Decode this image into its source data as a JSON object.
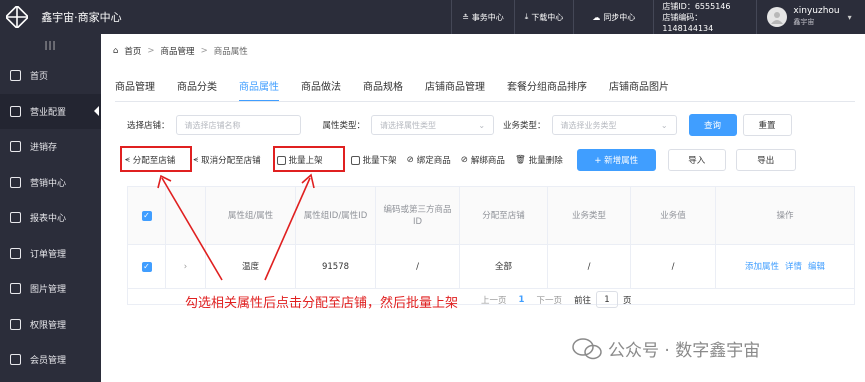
{
  "topbar": {
    "brand": "鑫宇宙·商家中心",
    "tasks": "事务中心",
    "downloads": "下载中心",
    "sync": "同步中心",
    "store_id": "店铺ID：6555146",
    "store_code": "店铺编码：1148144134",
    "user_name": "xinyuzhou",
    "user_sub": "鑫宇宙",
    "dropdown_arrow": "▾"
  },
  "sidebar": {
    "collapse": "|||",
    "items": [
      {
        "label": "首页",
        "icon": "home-icon"
      },
      {
        "label": "营业配置",
        "icon": "store-icon"
      },
      {
        "label": "进销存",
        "icon": "inventory-icon"
      },
      {
        "label": "营销中心",
        "icon": "marketing-icon"
      },
      {
        "label": "报表中心",
        "icon": "report-icon"
      },
      {
        "label": "订单管理",
        "icon": "order-icon"
      },
      {
        "label": "图片管理",
        "icon": "image-icon"
      },
      {
        "label": "权限管理",
        "icon": "permission-icon"
      },
      {
        "label": "会员管理",
        "icon": "member-icon"
      }
    ]
  },
  "breadcrumb": {
    "home": "首页",
    "sep": ">",
    "section": "商品管理",
    "current": "商品属性"
  },
  "tabs": [
    "商品管理",
    "商品分类",
    "商品属性",
    "商品做法",
    "商品规格",
    "店铺商品管理",
    "套餐分组商品排序",
    "店铺商品图片"
  ],
  "filters": {
    "store_label": "选择店铺：",
    "store_placeholder": "请选择店铺名称",
    "attr_type_label": "属性类型：",
    "attr_type_placeholder": "请选择属性类型",
    "biz_type_label": "业务类型：",
    "biz_type_placeholder": "请选择业务类型",
    "query": "查询",
    "reset": "重置"
  },
  "actions": {
    "assign": "分配至店铺",
    "unassign": "取消分配至店铺",
    "batch_on": "批量上架",
    "batch_off": "批量下架",
    "bind": "绑定商品",
    "unbind": "解绑商品",
    "batch_delete": "批量删除",
    "add_attr": "+ 新增属性",
    "import": "导入",
    "export": "导出"
  },
  "table": {
    "headers": [
      "属性组/属性",
      "属性组ID/属性ID",
      "编码或第三方商品ID",
      "分配至店铺",
      "业务类型",
      "业务值",
      "操作"
    ],
    "row": {
      "name": "温度",
      "id": "91578",
      "code": "/",
      "store": "全部",
      "biz_type": "/",
      "biz_value": "/",
      "ops": [
        "添加属性",
        "详情",
        "编辑"
      ]
    }
  },
  "pager": {
    "prev": "上一页",
    "page": "1",
    "next": "下一页",
    "goto_prefix": "前往",
    "goto_value": "1",
    "goto_suffix": "页"
  },
  "annotation": "勾选相关属性后点击分配至店铺，然后批量上架",
  "watermark": "公众号 · 数字鑫宇宙",
  "colors": {
    "accent": "#409eff",
    "sidebar": "#2b2d3a",
    "highlight": "#e02020"
  }
}
